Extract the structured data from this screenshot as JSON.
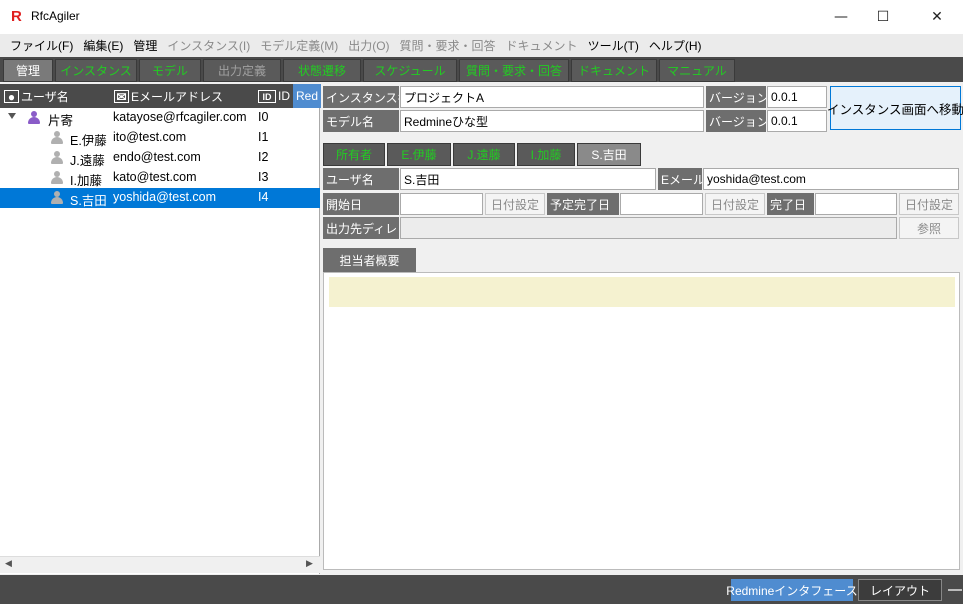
{
  "window": {
    "title": "RfcAgiler",
    "logo_letter": "R",
    "minimize": "—",
    "maximize": "☐",
    "close": "✕"
  },
  "menu": [
    {
      "label": "ファイル(F)",
      "enabled": true
    },
    {
      "label": "編集(E)",
      "enabled": true
    },
    {
      "label": "管理",
      "enabled": true
    },
    {
      "label": "インスタンス(I)",
      "enabled": false
    },
    {
      "label": "モデル定義(M)",
      "enabled": false
    },
    {
      "label": "出力(O)",
      "enabled": false
    },
    {
      "label": "質問・要求・回答",
      "enabled": false
    },
    {
      "label": "ドキュメント",
      "enabled": false
    },
    {
      "label": "ツール(T)",
      "enabled": true
    },
    {
      "label": "ヘルプ(H)",
      "enabled": true
    }
  ],
  "top_tabs": [
    "管理",
    "インスタンス",
    "モデル",
    "出力定義",
    "状態遷移",
    "スケジュール",
    "質問・要求・回答",
    "ドキュメント",
    "マニュアル"
  ],
  "tree": {
    "headers": {
      "user": "ユーザ名",
      "email": "Eメールアドレス",
      "id": "ID",
      "red": "Red"
    },
    "header_icons": {
      "user": "person-icon",
      "email": "mail-icon",
      "id": "ID"
    },
    "rows": [
      {
        "name": "片寄",
        "email": "katayose@rfcagiler.com",
        "id": "I0"
      },
      {
        "name": "E.伊藤",
        "email": "ito@test.com",
        "id": "I1"
      },
      {
        "name": "J.遠藤",
        "email": "endo@test.com",
        "id": "I2"
      },
      {
        "name": "I.加藤",
        "email": "kato@test.com",
        "id": "I3"
      },
      {
        "name": "S.吉田",
        "email": "yoshida@test.com",
        "id": "I4"
      }
    ]
  },
  "instance": {
    "instance_label": "インスタンス名",
    "instance_value": "プロジェクトA",
    "version_label": "バージョン",
    "instance_version": "0.0.1",
    "model_label": "モデル名",
    "model_value": "Redmineひな型",
    "model_version": "0.0.1",
    "move_button": "インスタンス画面へ移動"
  },
  "sub_tabs": [
    "所有者",
    "E.伊藤",
    "J.遠藤",
    "I.加藤",
    "S.吉田"
  ],
  "user_form": {
    "user_label": "ユーザ名",
    "user_value": "S.吉田",
    "email_label": "Eメール",
    "email_value": "yoshida@test.com",
    "start_label": "開始日",
    "date_set": "日付設定",
    "planned_label": "予定完了日",
    "done_label": "完了日",
    "outdir_label": "出力先ディレ",
    "browse": "参照"
  },
  "summary_tab": "担当者概要",
  "status": {
    "redmine": "Redmineインタフェース",
    "layout": "レイアウト"
  }
}
